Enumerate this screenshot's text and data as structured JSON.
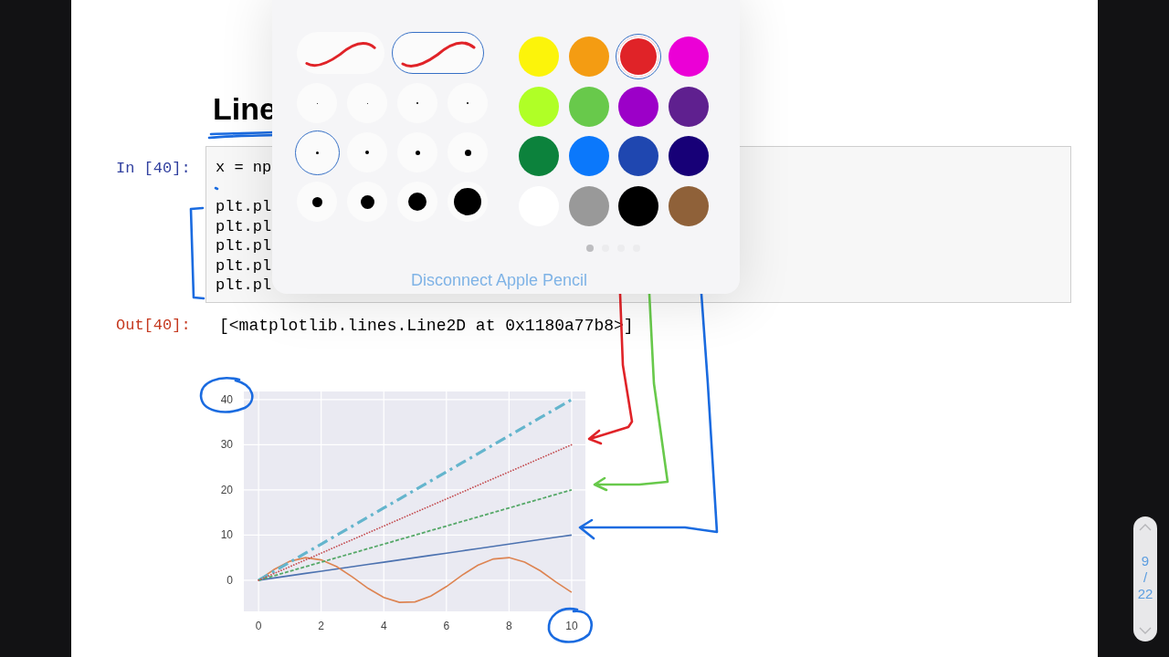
{
  "notebook": {
    "heading": "Line",
    "input_prompt": "In [40]:",
    "code_blocks": [
      [
        "x = np"
      ],
      [
        "plt.pl",
        "plt.pl",
        "plt.pl",
        "plt.pl",
        "plt.pl"
      ]
    ],
    "output_prompt": "Out[40]:",
    "output": "[<matplotlib.lines.Line2D at 0x1180a77b8>]",
    "chart_data": {
      "type": "line",
      "x": [
        0,
        0.5,
        1,
        1.5,
        2,
        2.5,
        3,
        3.5,
        4,
        4.5,
        5,
        5.5,
        6,
        6.5,
        7,
        7.5,
        8,
        8.5,
        9,
        9.5,
        10
      ],
      "series": [
        {
          "color": "#4c72b0",
          "line_style": "solid",
          "values": [
            0,
            0.5,
            1,
            1.5,
            2,
            2.5,
            3,
            3.5,
            4,
            4.5,
            5,
            5.5,
            6,
            6.5,
            7,
            7.5,
            8,
            8.5,
            9,
            9.5,
            10
          ]
        },
        {
          "color": "#55a868",
          "line_style": "dashed",
          "values": [
            0,
            1,
            2,
            3,
            4,
            5,
            6,
            7,
            8,
            9,
            10,
            11,
            12,
            13,
            14,
            15,
            16,
            17,
            18,
            19,
            20
          ]
        },
        {
          "color": "#c44e52",
          "line_style": "dotted",
          "values": [
            0,
            1.5,
            3,
            4.5,
            6,
            7.5,
            9,
            10.5,
            12,
            13.5,
            15,
            16.5,
            18,
            19.5,
            21,
            22.5,
            24,
            25.5,
            27,
            28.5,
            30
          ]
        },
        {
          "color": "#64b5cd",
          "line_style": "dashdot",
          "values": [
            0,
            2,
            4,
            6,
            8,
            10,
            12,
            14,
            16,
            18,
            20,
            22,
            24,
            26,
            28,
            30,
            32,
            34,
            36,
            38,
            40
          ]
        },
        {
          "color": "#dd8452",
          "line_style": "solid",
          "values": [
            0,
            2.4,
            4.2,
            5,
            4.5,
            3,
            0.7,
            -1.8,
            -3.8,
            -4.9,
            -4.8,
            -3.5,
            -1.4,
            1.1,
            3.3,
            4.7,
            5,
            4,
            2.1,
            -0.4,
            -2.7
          ]
        }
      ],
      "grid": true,
      "xlim": [
        -0.47,
        10.44
      ],
      "ylim": [
        -6.9,
        41.8
      ],
      "xticks": [
        0,
        2,
        4,
        6,
        8,
        10
      ],
      "yticks": [
        0,
        10,
        20,
        30,
        40
      ]
    }
  },
  "pencil_palette": {
    "strokes": [
      {
        "selected": false
      },
      {
        "selected": true
      }
    ],
    "sizes": [
      {
        "selected": false
      },
      {
        "selected": false
      },
      {
        "selected": false
      },
      {
        "selected": false
      },
      {
        "selected": true
      },
      {
        "selected": false
      },
      {
        "selected": false
      },
      {
        "selected": false
      },
      {
        "selected": false
      },
      {
        "selected": false
      },
      {
        "selected": false
      },
      {
        "selected": false
      }
    ],
    "colors": [
      {
        "color": "#fcf40a",
        "selected": false
      },
      {
        "color": "#f49c12",
        "selected": false
      },
      {
        "color": "#e02328",
        "selected": true
      },
      {
        "color": "#eb00d6",
        "selected": false
      },
      {
        "color": "#b0ff26",
        "selected": false
      },
      {
        "color": "#68c94b",
        "selected": false
      },
      {
        "color": "#9c00c8",
        "selected": false
      },
      {
        "color": "#5f208f",
        "selected": false
      },
      {
        "color": "#0c823c",
        "selected": false
      },
      {
        "color": "#0b78fb",
        "selected": false
      },
      {
        "color": "#1f47b0",
        "selected": false
      },
      {
        "color": "#170077",
        "selected": false
      },
      {
        "color": "#ffffff",
        "selected": false
      },
      {
        "color": "#999999",
        "selected": false
      },
      {
        "color": "#000000",
        "selected": false
      },
      {
        "color": "#8f6139",
        "selected": false
      }
    ],
    "page_dots": [
      {
        "selected": true
      },
      {
        "selected": false
      },
      {
        "selected": false
      },
      {
        "selected": false
      }
    ],
    "disconnect_link": "Disconnect Apple Pencil"
  },
  "page_indicator": {
    "page": "9",
    "separator": "/",
    "total": "22"
  }
}
